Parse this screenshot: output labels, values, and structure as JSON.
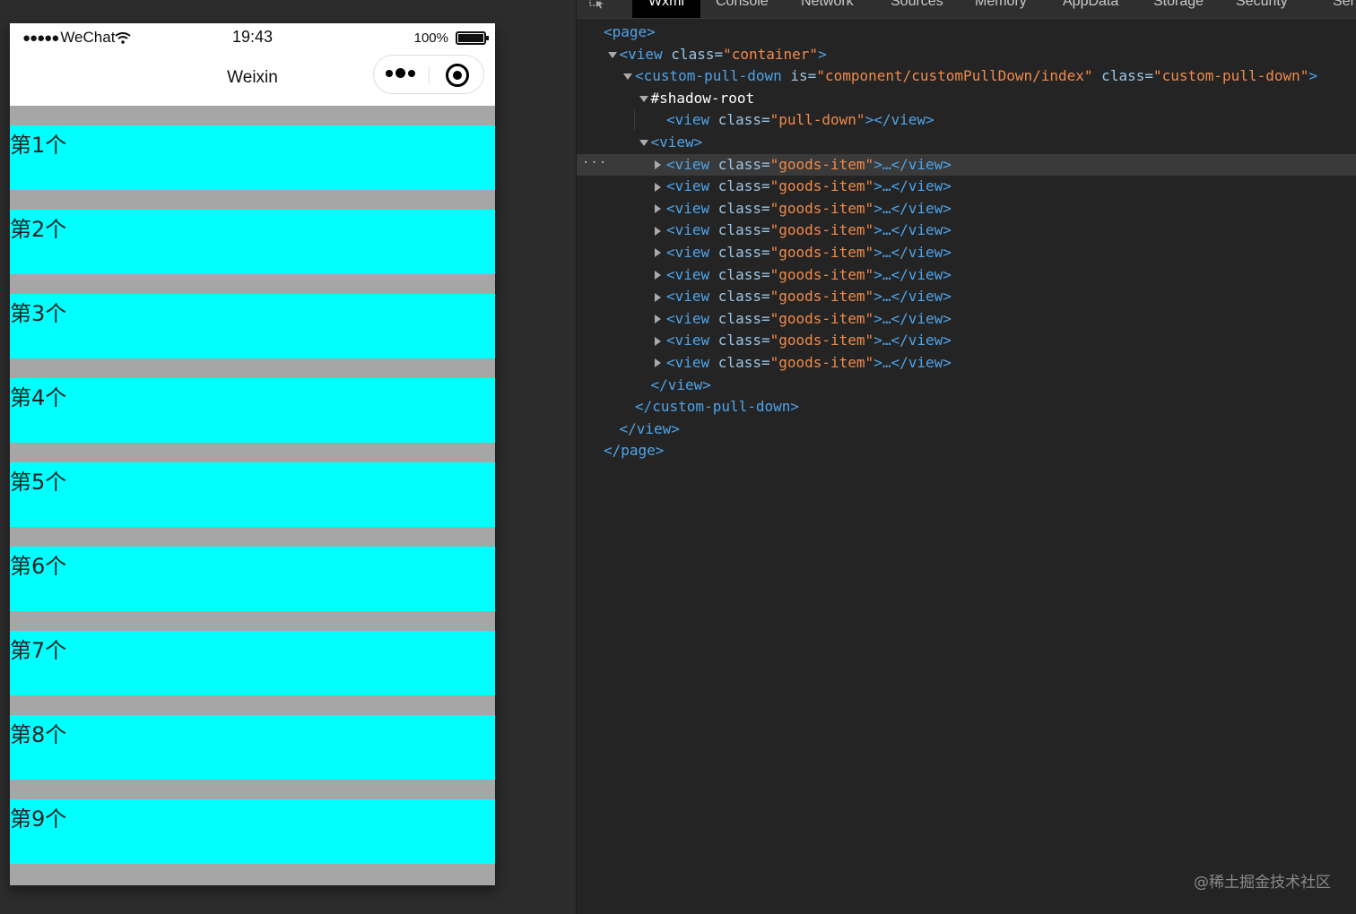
{
  "status_bar": {
    "signal_dots": "●●●●●",
    "carrier": "WeChat",
    "time": "19:43",
    "battery_percent": "100%"
  },
  "nav_bar": {
    "title": "Weixin"
  },
  "goods_items": [
    "第1个",
    "第2个",
    "第3个",
    "第4个",
    "第5个",
    "第6个",
    "第7个",
    "第8个",
    "第9个"
  ],
  "colors": {
    "goods_item_bg": "#00ffff",
    "page_bg": "#a6a6a6",
    "devtools_bg": "#242424"
  },
  "devtools": {
    "tabs": [
      "Wxml",
      "Console",
      "Network",
      "Sources",
      "Memory",
      "AppData",
      "Storage",
      "Security",
      "Sen"
    ],
    "active_tab": "Wxml",
    "tree": [
      {
        "indent": 0,
        "toggle": "",
        "parts": [
          [
            "tg",
            "<page>"
          ]
        ]
      },
      {
        "indent": 1,
        "toggle": "down",
        "parts": [
          [
            "tg",
            "<view "
          ],
          [
            "at",
            "class="
          ],
          [
            "av",
            "\"container\""
          ],
          [
            "tg",
            ">"
          ]
        ]
      },
      {
        "indent": 2,
        "toggle": "down",
        "parts": [
          [
            "tg",
            "<custom-pull-down "
          ],
          [
            "at",
            "is="
          ],
          [
            "av",
            "\"component/customPullDown/index\""
          ],
          [
            "at",
            " class="
          ],
          [
            "av",
            "\"custom-pull-down\""
          ],
          [
            "tg",
            ">"
          ]
        ]
      },
      {
        "indent": 3,
        "toggle": "down",
        "parts": [
          [
            "shadow",
            "#shadow-root"
          ]
        ]
      },
      {
        "indent": 4,
        "toggle": "",
        "parts": [
          [
            "tg",
            "<view "
          ],
          [
            "at",
            "class="
          ],
          [
            "av",
            "\"pull-down\""
          ],
          [
            "tg",
            "></view>"
          ]
        ]
      },
      {
        "indent": 3,
        "toggle": "down",
        "parts": [
          [
            "tg",
            "<view>"
          ]
        ]
      },
      {
        "indent": 4,
        "toggle": "right",
        "highlight": true,
        "parts": [
          [
            "tg",
            "<view "
          ],
          [
            "at",
            "class="
          ],
          [
            "av",
            "\"goods-item\""
          ],
          [
            "tg",
            ">…</view>"
          ]
        ]
      },
      {
        "indent": 4,
        "toggle": "right",
        "parts": [
          [
            "tg",
            "<view "
          ],
          [
            "at",
            "class="
          ],
          [
            "av",
            "\"goods-item\""
          ],
          [
            "tg",
            ">…</view>"
          ]
        ]
      },
      {
        "indent": 4,
        "toggle": "right",
        "parts": [
          [
            "tg",
            "<view "
          ],
          [
            "at",
            "class="
          ],
          [
            "av",
            "\"goods-item\""
          ],
          [
            "tg",
            ">…</view>"
          ]
        ]
      },
      {
        "indent": 4,
        "toggle": "right",
        "parts": [
          [
            "tg",
            "<view "
          ],
          [
            "at",
            "class="
          ],
          [
            "av",
            "\"goods-item\""
          ],
          [
            "tg",
            ">…</view>"
          ]
        ]
      },
      {
        "indent": 4,
        "toggle": "right",
        "parts": [
          [
            "tg",
            "<view "
          ],
          [
            "at",
            "class="
          ],
          [
            "av",
            "\"goods-item\""
          ],
          [
            "tg",
            ">…</view>"
          ]
        ]
      },
      {
        "indent": 4,
        "toggle": "right",
        "parts": [
          [
            "tg",
            "<view "
          ],
          [
            "at",
            "class="
          ],
          [
            "av",
            "\"goods-item\""
          ],
          [
            "tg",
            ">…</view>"
          ]
        ]
      },
      {
        "indent": 4,
        "toggle": "right",
        "parts": [
          [
            "tg",
            "<view "
          ],
          [
            "at",
            "class="
          ],
          [
            "av",
            "\"goods-item\""
          ],
          [
            "tg",
            ">…</view>"
          ]
        ]
      },
      {
        "indent": 4,
        "toggle": "right",
        "parts": [
          [
            "tg",
            "<view "
          ],
          [
            "at",
            "class="
          ],
          [
            "av",
            "\"goods-item\""
          ],
          [
            "tg",
            ">…</view>"
          ]
        ]
      },
      {
        "indent": 4,
        "toggle": "right",
        "parts": [
          [
            "tg",
            "<view "
          ],
          [
            "at",
            "class="
          ],
          [
            "av",
            "\"goods-item\""
          ],
          [
            "tg",
            ">…</view>"
          ]
        ]
      },
      {
        "indent": 4,
        "toggle": "right",
        "parts": [
          [
            "tg",
            "<view "
          ],
          [
            "at",
            "class="
          ],
          [
            "av",
            "\"goods-item\""
          ],
          [
            "tg",
            ">…</view>"
          ]
        ]
      },
      {
        "indent": 3,
        "toggle": "",
        "parts": [
          [
            "tg",
            "</view>"
          ]
        ]
      },
      {
        "indent": 2,
        "toggle": "",
        "parts": [
          [
            "tg",
            "</custom-pull-down>"
          ]
        ]
      },
      {
        "indent": 1,
        "toggle": "",
        "parts": [
          [
            "tg",
            "</view>"
          ]
        ]
      },
      {
        "indent": 0,
        "toggle": "",
        "parts": [
          [
            "tg",
            "</page>"
          ]
        ]
      }
    ],
    "more_glyph": "···"
  },
  "watermark": "@稀土掘金技术社区"
}
